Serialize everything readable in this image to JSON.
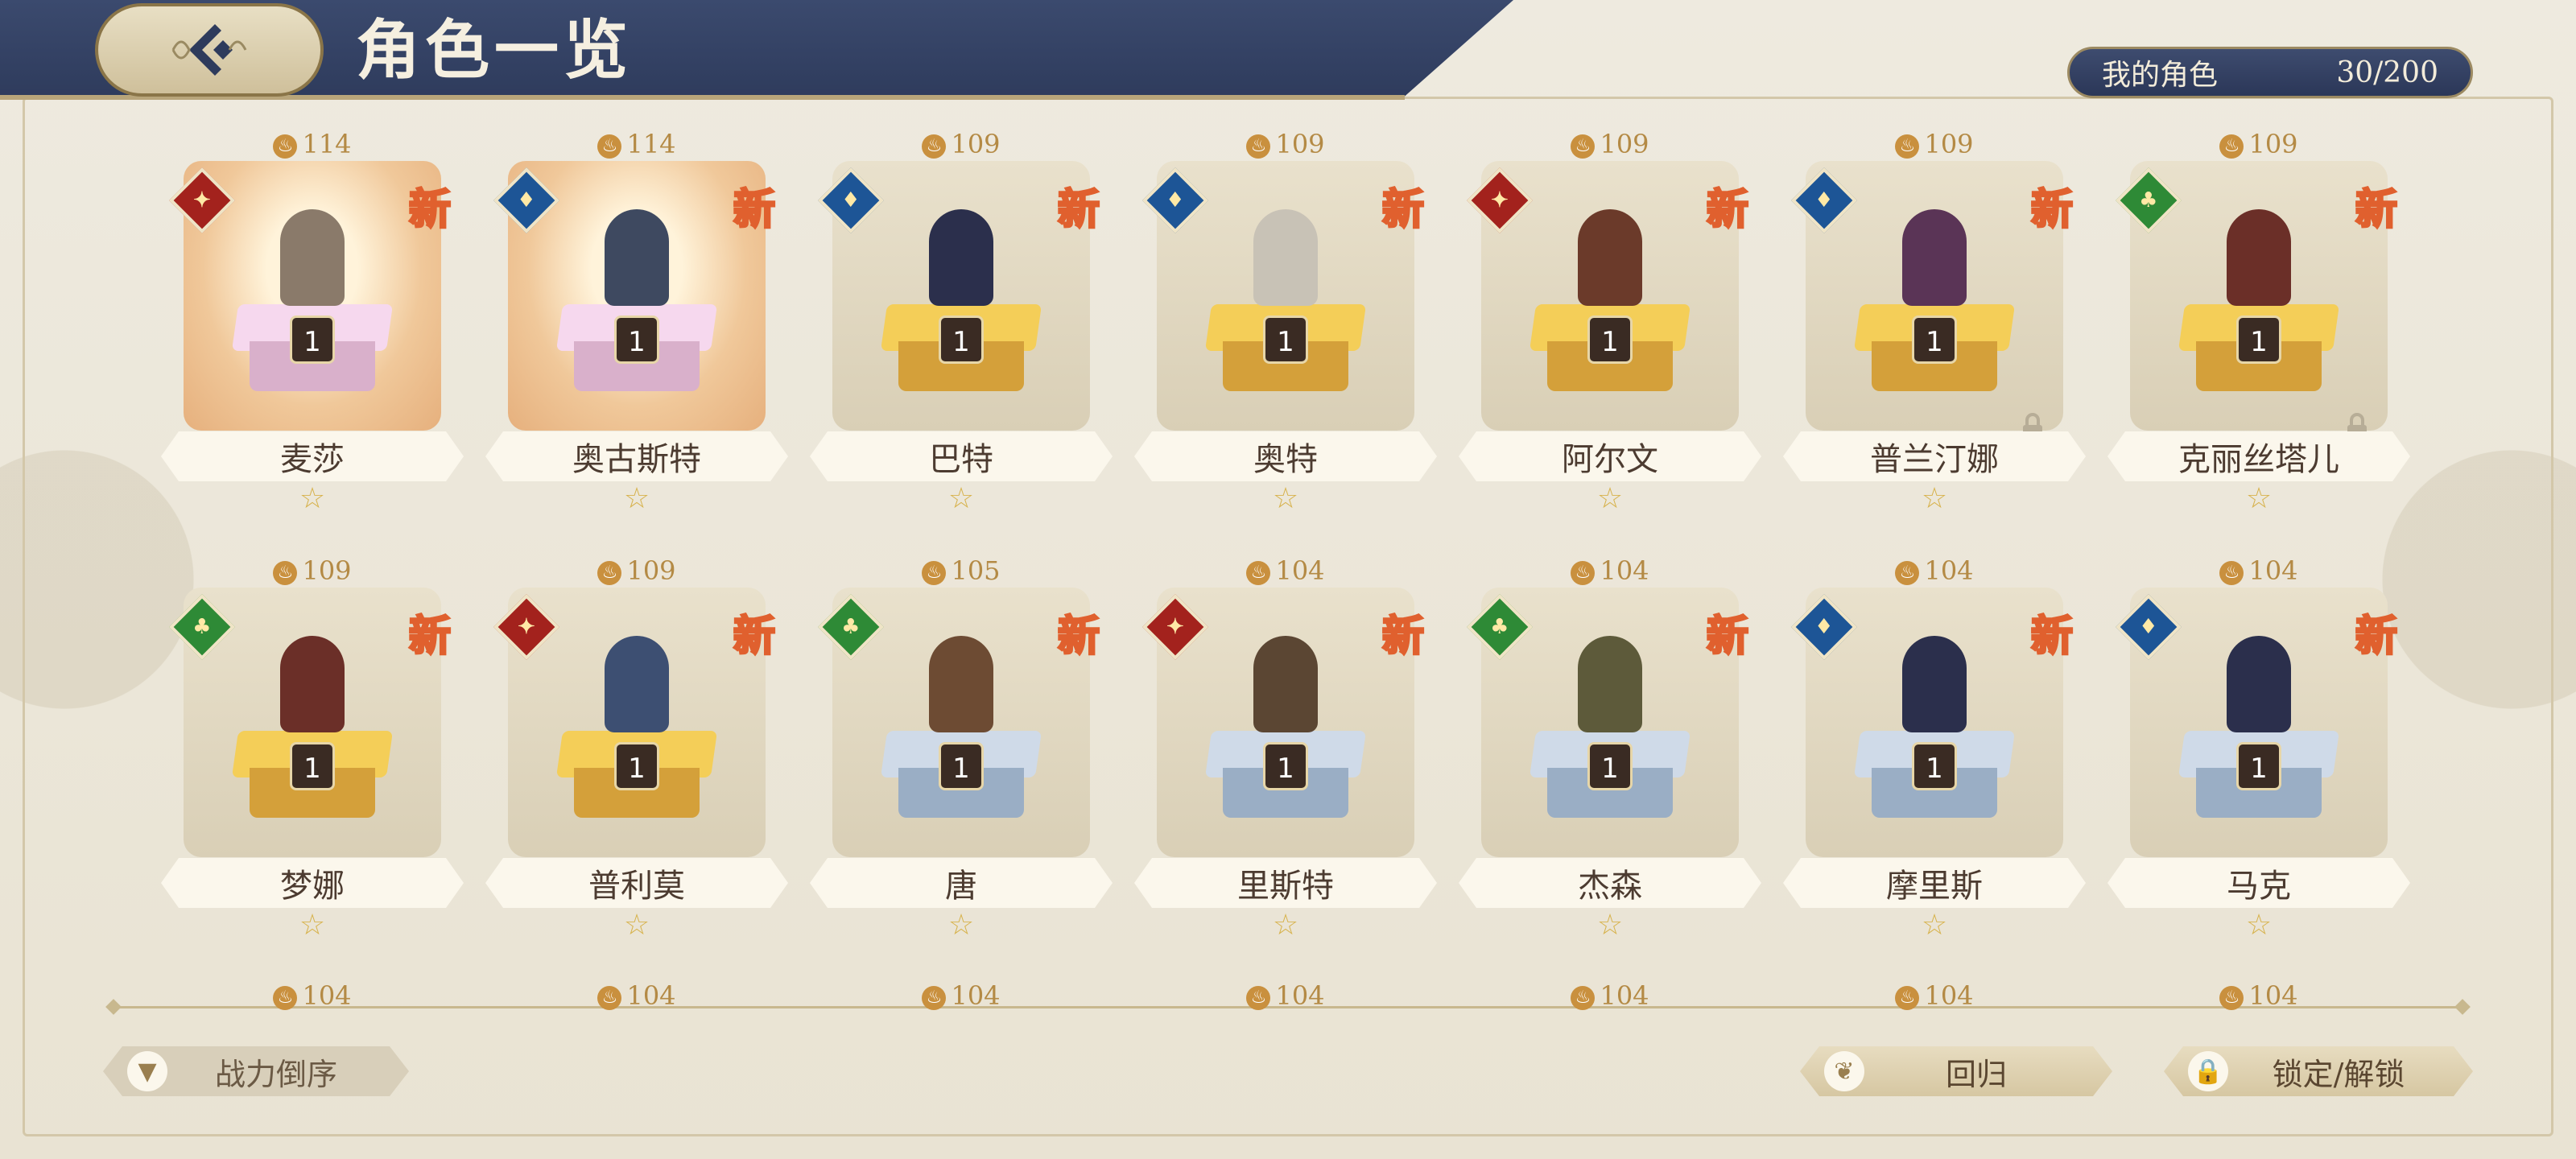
{
  "header": {
    "title": "角色一览",
    "back_icon": "back-arrow-icon"
  },
  "counter": {
    "label": "我的角色",
    "value": "30/200"
  },
  "colors": {
    "header_bg": "#2e3b5c",
    "accent": "#b48a45",
    "new_badge": "#e0602e"
  },
  "new_label": "新",
  "level": "1",
  "star": "☆",
  "cards": [
    {
      "name": "麦莎",
      "power": "114",
      "element": "red",
      "rarity": "gold",
      "pedestal": "pink",
      "color": "#8a7a6a",
      "locked": false
    },
    {
      "name": "奥古斯特",
      "power": "114",
      "element": "blue",
      "rarity": "gold",
      "pedestal": "pink",
      "color": "#3e4960",
      "locked": false
    },
    {
      "name": "巴特",
      "power": "109",
      "element": "blue",
      "rarity": "normal",
      "pedestal": "gold",
      "color": "#2b2f4c",
      "locked": false
    },
    {
      "name": "奥特",
      "power": "109",
      "element": "blue",
      "rarity": "normal",
      "pedestal": "gold",
      "color": "#c8c2b6",
      "locked": false
    },
    {
      "name": "阿尔文",
      "power": "109",
      "element": "red",
      "rarity": "normal",
      "pedestal": "gold",
      "color": "#6b3a2a",
      "locked": false
    },
    {
      "name": "普兰汀娜",
      "power": "109",
      "element": "blue",
      "rarity": "normal",
      "pedestal": "gold",
      "color": "#5a3456",
      "locked": true
    },
    {
      "name": "克丽丝塔儿",
      "power": "109",
      "element": "green",
      "rarity": "normal",
      "pedestal": "gold",
      "color": "#6b2f28",
      "locked": true
    },
    {
      "name": "梦娜",
      "power": "109",
      "element": "green",
      "rarity": "normal",
      "pedestal": "gold",
      "color": "#6b2f28",
      "locked": false
    },
    {
      "name": "普利莫",
      "power": "109",
      "element": "red",
      "rarity": "normal",
      "pedestal": "gold",
      "color": "#3d4f72",
      "locked": false
    },
    {
      "name": "唐",
      "power": "105",
      "element": "green",
      "rarity": "normal",
      "pedestal": "blue",
      "color": "#6d4b33",
      "locked": false
    },
    {
      "name": "里斯特",
      "power": "104",
      "element": "red",
      "rarity": "normal",
      "pedestal": "blue",
      "color": "#5b4633",
      "locked": false
    },
    {
      "name": "杰森",
      "power": "104",
      "element": "green",
      "rarity": "normal",
      "pedestal": "blue",
      "color": "#5d5a3a",
      "locked": false
    },
    {
      "name": "摩里斯",
      "power": "104",
      "element": "blue",
      "rarity": "normal",
      "pedestal": "blue",
      "color": "#2b2f4c",
      "locked": false
    },
    {
      "name": "马克",
      "power": "104",
      "element": "blue",
      "rarity": "normal",
      "pedestal": "blue",
      "color": "#2b2f4c",
      "locked": false
    }
  ],
  "next_row_powers": [
    "104",
    "104",
    "104",
    "104",
    "104",
    "104",
    "104"
  ],
  "buttons": {
    "sort_label": "战力倒序",
    "return_label": "回归",
    "lock_label": "锁定/解锁"
  }
}
